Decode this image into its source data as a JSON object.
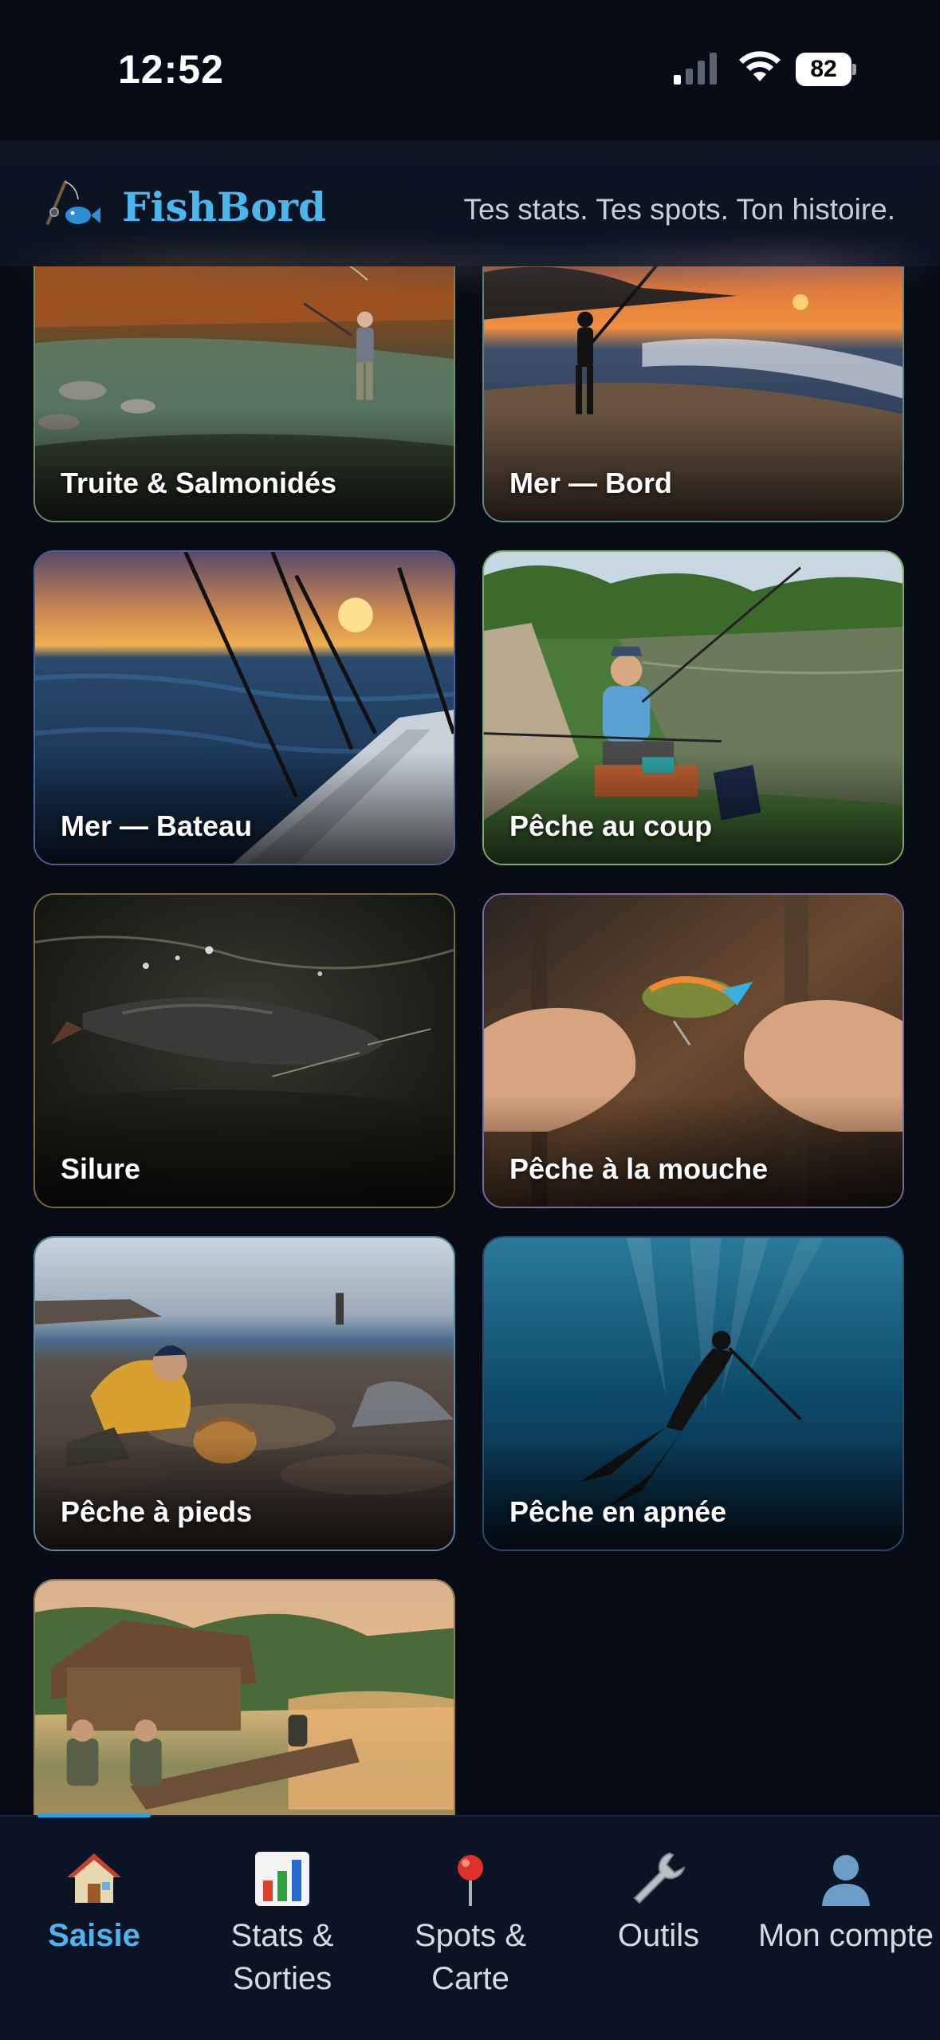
{
  "status_bar": {
    "time": "12:52",
    "battery": "82"
  },
  "header": {
    "app_name": "FishBord",
    "tagline": "Tes stats. Tes spots. Ton histoire."
  },
  "categories": [
    {
      "label": "Truite & Salmonidés"
    },
    {
      "label": "Mer — Bord"
    },
    {
      "label": "Mer — Bateau"
    },
    {
      "label": "Pêche au coup"
    },
    {
      "label": "Silure"
    },
    {
      "label": "Pêche à la mouche"
    },
    {
      "label": "Pêche à pieds"
    },
    {
      "label": "Pêche en apnée"
    },
    {
      "label": ""
    }
  ],
  "tabs": [
    {
      "label": "Saisie",
      "icon": "house-icon",
      "active": true
    },
    {
      "label": "Stats & Sorties",
      "icon": "bar-chart-icon",
      "active": false
    },
    {
      "label": "Spots & Carte",
      "icon": "pushpin-icon",
      "active": false
    },
    {
      "label": "Outils",
      "icon": "wrench-icon",
      "active": false
    },
    {
      "label": "Mon compte",
      "icon": "user-icon",
      "active": false
    }
  ],
  "colors": {
    "accent": "#4cb4ee",
    "background": "#060b16"
  }
}
